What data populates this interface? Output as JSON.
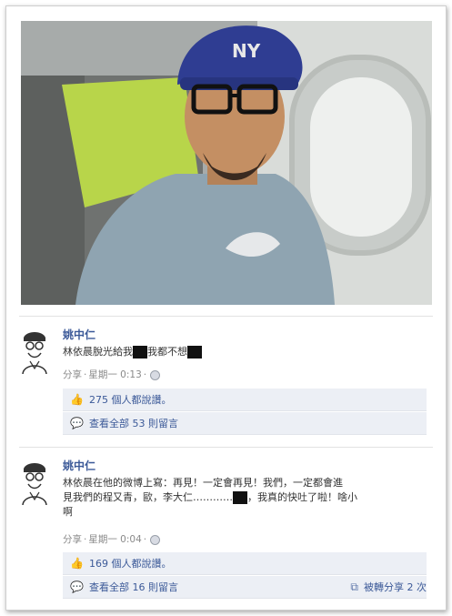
{
  "posts": [
    {
      "author": "姚中仁",
      "message_line1_a": "林依晨脫光給我",
      "message_line1_b": "我都不想",
      "meta_share": "分享",
      "meta_time": "星期一 0:13",
      "likes_text": "275 個人都說讚。",
      "comments_text": "查看全部 53 則留言"
    },
    {
      "author": "姚中仁",
      "message_line1": "林依晨在他的微博上寫：再見！一定會再見！我們，一定都會進",
      "message_line2_a": "見我們的程又青，歐，李大仁…………",
      "message_line2_b": "，我真的快吐了啦！啥小",
      "message_line3": "啊",
      "meta_share": "分享",
      "meta_time": "星期一 0:04",
      "likes_text": "169 個人都說讚。",
      "comments_text": "查看全部 16 則留言",
      "shares_text": "被轉分享 2 次"
    }
  ],
  "icons": {
    "like": "thumbs-up-icon",
    "comment": "comment-icon",
    "share": "share-icon",
    "globe": "globe-icon"
  }
}
